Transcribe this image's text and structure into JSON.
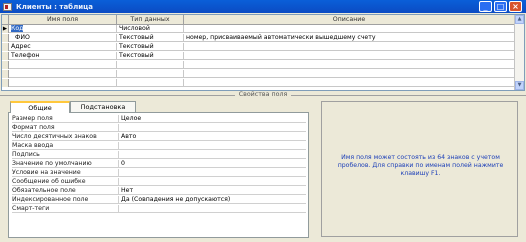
{
  "window": {
    "title": "Клиенты : таблица",
    "controls": {
      "minimize": "_",
      "maximize": "□",
      "close": "×"
    }
  },
  "grid": {
    "columns": [
      "Имя поля",
      "Тип данных",
      "Описание"
    ],
    "rows": [
      {
        "marker": "▶",
        "name": "Код",
        "type": "Числовой",
        "desc": "",
        "selected": true
      },
      {
        "marker": "",
        "name": "ФИО",
        "type": "Текстовый",
        "desc": "номер, присваиваемый автоматически вышедшему счету"
      },
      {
        "marker": "",
        "name": "Адрес",
        "type": "Текстовый",
        "desc": ""
      },
      {
        "marker": "",
        "name": "Телефон",
        "type": "Текстовый",
        "desc": ""
      },
      {
        "marker": "",
        "name": "",
        "type": "",
        "desc": ""
      },
      {
        "marker": "",
        "name": "",
        "type": "",
        "desc": ""
      },
      {
        "marker": "",
        "name": "",
        "type": "",
        "desc": ""
      }
    ]
  },
  "properties_caption": "Свойства поля",
  "tabs": [
    {
      "label": "Общие",
      "active": true
    },
    {
      "label": "Подстановка",
      "active": false
    }
  ],
  "properties": [
    {
      "label": "Размер поля",
      "value": "Целое"
    },
    {
      "label": "Формат поля",
      "value": ""
    },
    {
      "label": "Число десятичных знаков",
      "value": "Авто"
    },
    {
      "label": "Маска ввода",
      "value": ""
    },
    {
      "label": "Подпись",
      "value": ""
    },
    {
      "label": "Значение по умолчанию",
      "value": "0"
    },
    {
      "label": "Условие на значение",
      "value": ""
    },
    {
      "label": "Сообщение об ошибке",
      "value": ""
    },
    {
      "label": "Обязательное поле",
      "value": "Нет"
    },
    {
      "label": "Индексированное поле",
      "value": "Да (Совпадения не допускаются)"
    },
    {
      "label": "Смарт-теги",
      "value": ""
    }
  ],
  "hint": "Имя поля может состоять из 64 знаков с учетом пробелов. Для справки по именам полей нажмите клавишу F1.",
  "colors": {
    "titlebar": "#0b52cf",
    "selection": "#316ac5",
    "hint_text": "#1c3fb8"
  }
}
